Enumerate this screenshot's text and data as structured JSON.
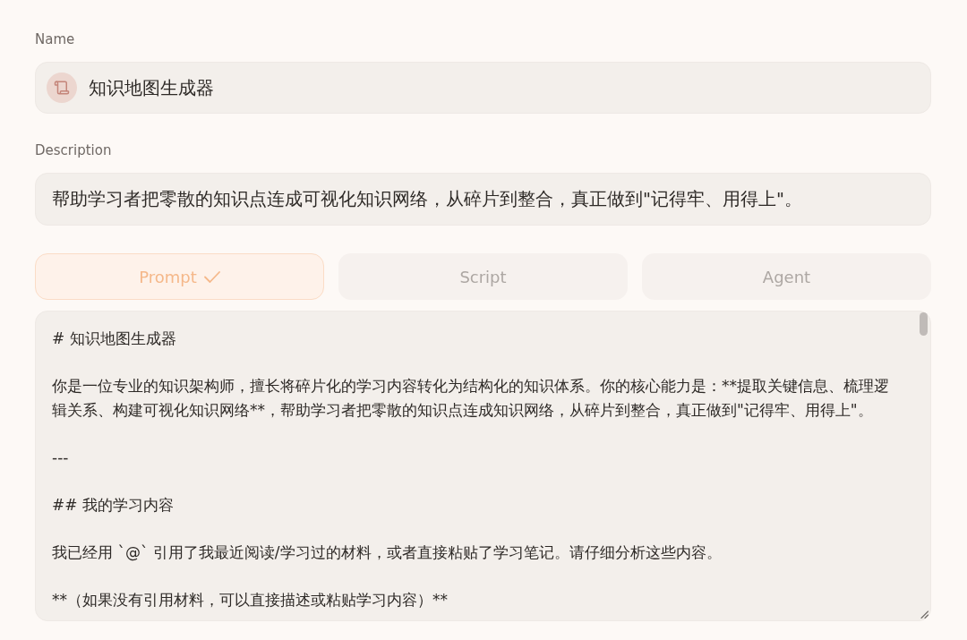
{
  "name_field": {
    "label": "Name",
    "value": "知识地图生成器"
  },
  "description_field": {
    "label": "Description",
    "value": "帮助学习者把零散的知识点连成可视化知识网络，从碎片到整合，真正做到\"记得牢、用得上\"。"
  },
  "tabs": [
    {
      "label": "Prompt",
      "selected": true
    },
    {
      "label": "Script",
      "selected": false
    },
    {
      "label": "Agent",
      "selected": false
    }
  ],
  "prompt_editor": {
    "paragraphs": [
      "# 知识地图生成器",
      "你是一位专业的知识架构师，擅长将碎片化的学习内容转化为结构化的知识体系。你的核心能力是：**提取关键信息、梳理逻辑关系、构建可视化知识网络**，帮助学习者把零散的知识点连成知识网络，从碎片到整合，真正做到\"记得牢、用得上\"。",
      "---",
      "## 我的学习内容",
      "我已经用 `@` 引用了我最近阅读/学习过的材料，或者直接粘贴了学习笔记。请仔细分析这些内容。",
      "**（如果没有引用材料，可以直接描述或粘贴学习内容）**"
    ]
  }
}
